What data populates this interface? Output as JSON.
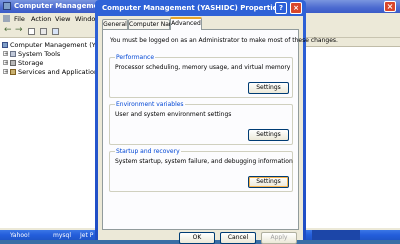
{
  "background_window": {
    "title": "Computer Management",
    "close_glyph": "×",
    "menu": [
      "File",
      "Action",
      "View",
      "Window"
    ],
    "tree": {
      "root": "Computer Management (YASHIDC)",
      "items": [
        "System Tools",
        "Storage",
        "Services and Applications"
      ]
    }
  },
  "taskbar": {
    "items": [
      "Yahoo!",
      "mysql",
      "Jet P"
    ]
  },
  "dialog": {
    "title": "Computer Management (YASHIDC) Properties",
    "help_glyph": "?",
    "close_glyph": "×",
    "tabs": [
      "General",
      "Computer Name",
      "Advanced"
    ],
    "active_tab": "Advanced",
    "admin_note": "You must be logged on as an Administrator to make most of these changes.",
    "groups": [
      {
        "title": "Performance",
        "description": "Processor scheduling, memory usage, and virtual memory",
        "button": "Settings"
      },
      {
        "title": "Environment variables",
        "description": "User and system environment settings",
        "button": "Settings"
      },
      {
        "title": "Startup and recovery",
        "description": "System startup, system failure, and debugging information",
        "button": "Settings"
      }
    ],
    "buttons": {
      "ok": "OK",
      "cancel": "Cancel",
      "apply": "Apply"
    }
  },
  "colors": {
    "title_bar": "#2f63d8",
    "close_button": "#d9472b",
    "group_title": "#0046d5",
    "desktop": "#3a6ea5"
  }
}
